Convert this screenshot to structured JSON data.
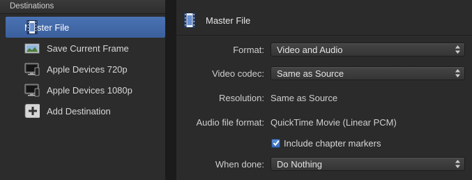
{
  "sidebar": {
    "header": "Destinations",
    "items": [
      {
        "label": "Master File",
        "icon": "film-document-icon",
        "selected": true
      },
      {
        "label": "Save Current Frame",
        "icon": "landscape-image-icon",
        "selected": false
      },
      {
        "label": "Apple Devices 720p",
        "icon": "devices-icon",
        "selected": false
      },
      {
        "label": "Apple Devices 1080p",
        "icon": "devices-icon",
        "selected": false
      },
      {
        "label": "Add Destination",
        "icon": "plus-icon",
        "selected": false
      }
    ]
  },
  "main": {
    "title": "Master File",
    "icon": "film-document-icon",
    "format": {
      "label": "Format:",
      "value": "Video and Audio"
    },
    "video_codec": {
      "label": "Video codec:",
      "value": "Same as Source"
    },
    "resolution": {
      "label": "Resolution:",
      "value": "Same as Source"
    },
    "audio_format": {
      "label": "Audio file format:",
      "value": "QuickTime Movie (Linear PCM)"
    },
    "chapter_markers": {
      "label": "Include chapter markers",
      "checked": true
    },
    "when_done": {
      "label": "When done:",
      "value": "Do Nothing"
    }
  },
  "colors": {
    "selection": "#3f66a6",
    "checkbox": "#3d74c6"
  }
}
